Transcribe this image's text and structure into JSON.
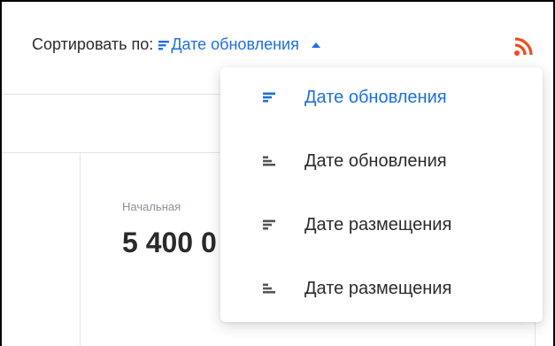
{
  "sort": {
    "label": "Сортировать по:",
    "current": "Дате обновления",
    "current_icon": "sort-desc-icon"
  },
  "options": [
    {
      "label": "Дате обновления",
      "icon": "sort-desc-icon",
      "active": true
    },
    {
      "label": "Дате обновления",
      "icon": "sort-asc-icon",
      "active": false
    },
    {
      "label": "Дате размещения",
      "icon": "sort-desc-icon",
      "active": false
    },
    {
      "label": "Дате размещения",
      "icon": "sort-asc-icon",
      "active": false
    }
  ],
  "card": {
    "subtitle": "Начальная",
    "value": "5 400 0"
  },
  "colors": {
    "accent": "#1f6fe0",
    "rss": "#f24b1a",
    "muted_icon": "#555555"
  }
}
